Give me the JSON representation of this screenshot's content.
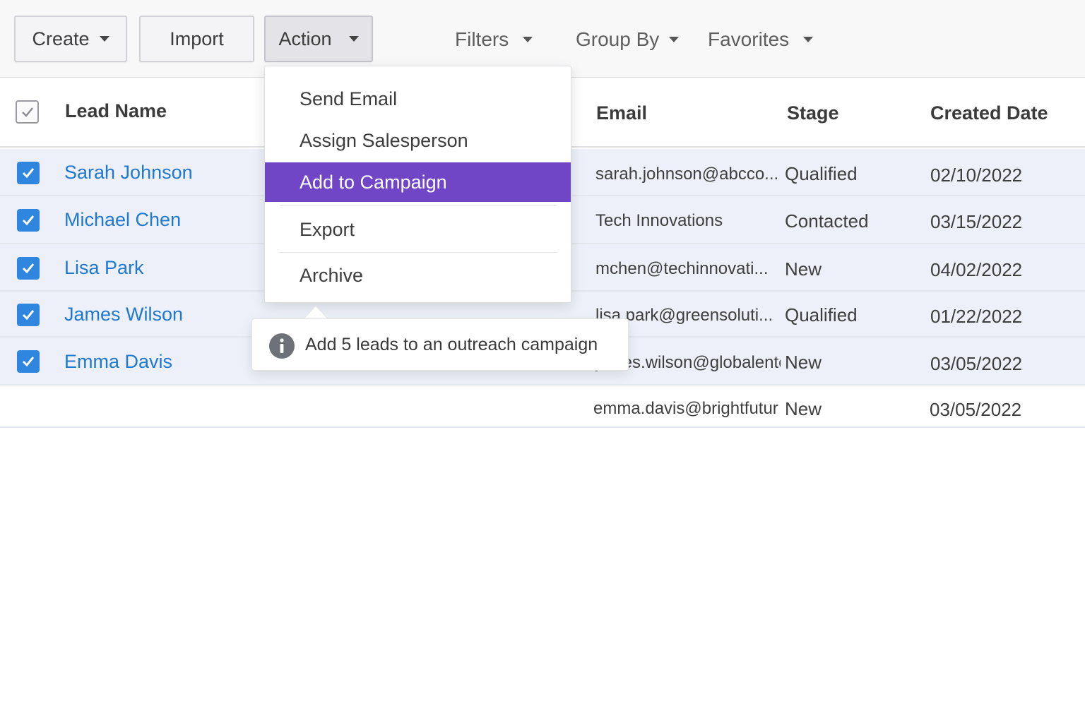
{
  "toolbar": {
    "create_label": "Create",
    "import_label": "Import",
    "action_label": "Action",
    "filters_label": "Filters",
    "group_by_label": "Group By",
    "favorites_label": "Favorites"
  },
  "table": {
    "headers": {
      "lead_name": "Lead Name",
      "email": "Email",
      "stage": "Stage",
      "created_date": "Created Date"
    },
    "rows": [
      {
        "lead_name": "Sarah Johnson",
        "email": "sarah.johnson@abcco...",
        "stage": "Qualified",
        "created_date": "02/10/2022",
        "selected": true
      },
      {
        "lead_name": "Michael Chen",
        "email": "Tech Innovations",
        "stage": "Contacted",
        "created_date": "03/15/2022",
        "selected": true
      },
      {
        "lead_name": "Lisa Park",
        "email": "mchen@techinnovati...",
        "stage": "New",
        "created_date": "04/02/2022",
        "selected": true
      },
      {
        "lead_name": "James Wilson",
        "email": "lisa.park@greensoluti...",
        "stage": "Qualified",
        "created_date": "01/22/2022",
        "selected": true
      },
      {
        "lead_name": "Emma Davis",
        "email": "james.wilson@globalenterpri...",
        "stage": "New",
        "created_date": "03/05/2022",
        "selected": true
      },
      {
        "lead_name": "",
        "email": "emma.davis@brightfutur..",
        "stage": "New",
        "created_date": "03/05/2022",
        "selected": false
      }
    ]
  },
  "action_menu": {
    "items": [
      "Send Email",
      "Assign Salesperson",
      "Add to Campaign",
      "Export",
      "Archive"
    ],
    "highlighted": "Add to Campaign"
  },
  "tooltip": {
    "text": "Add 5 leads to an outreach campaign",
    "icon": "info-icon"
  },
  "colors": {
    "accent_purple": "#7045c6",
    "checkbox_blue": "#2f86de",
    "link_blue": "#1f78d1",
    "selected_row_bg": "#edf0f9"
  }
}
